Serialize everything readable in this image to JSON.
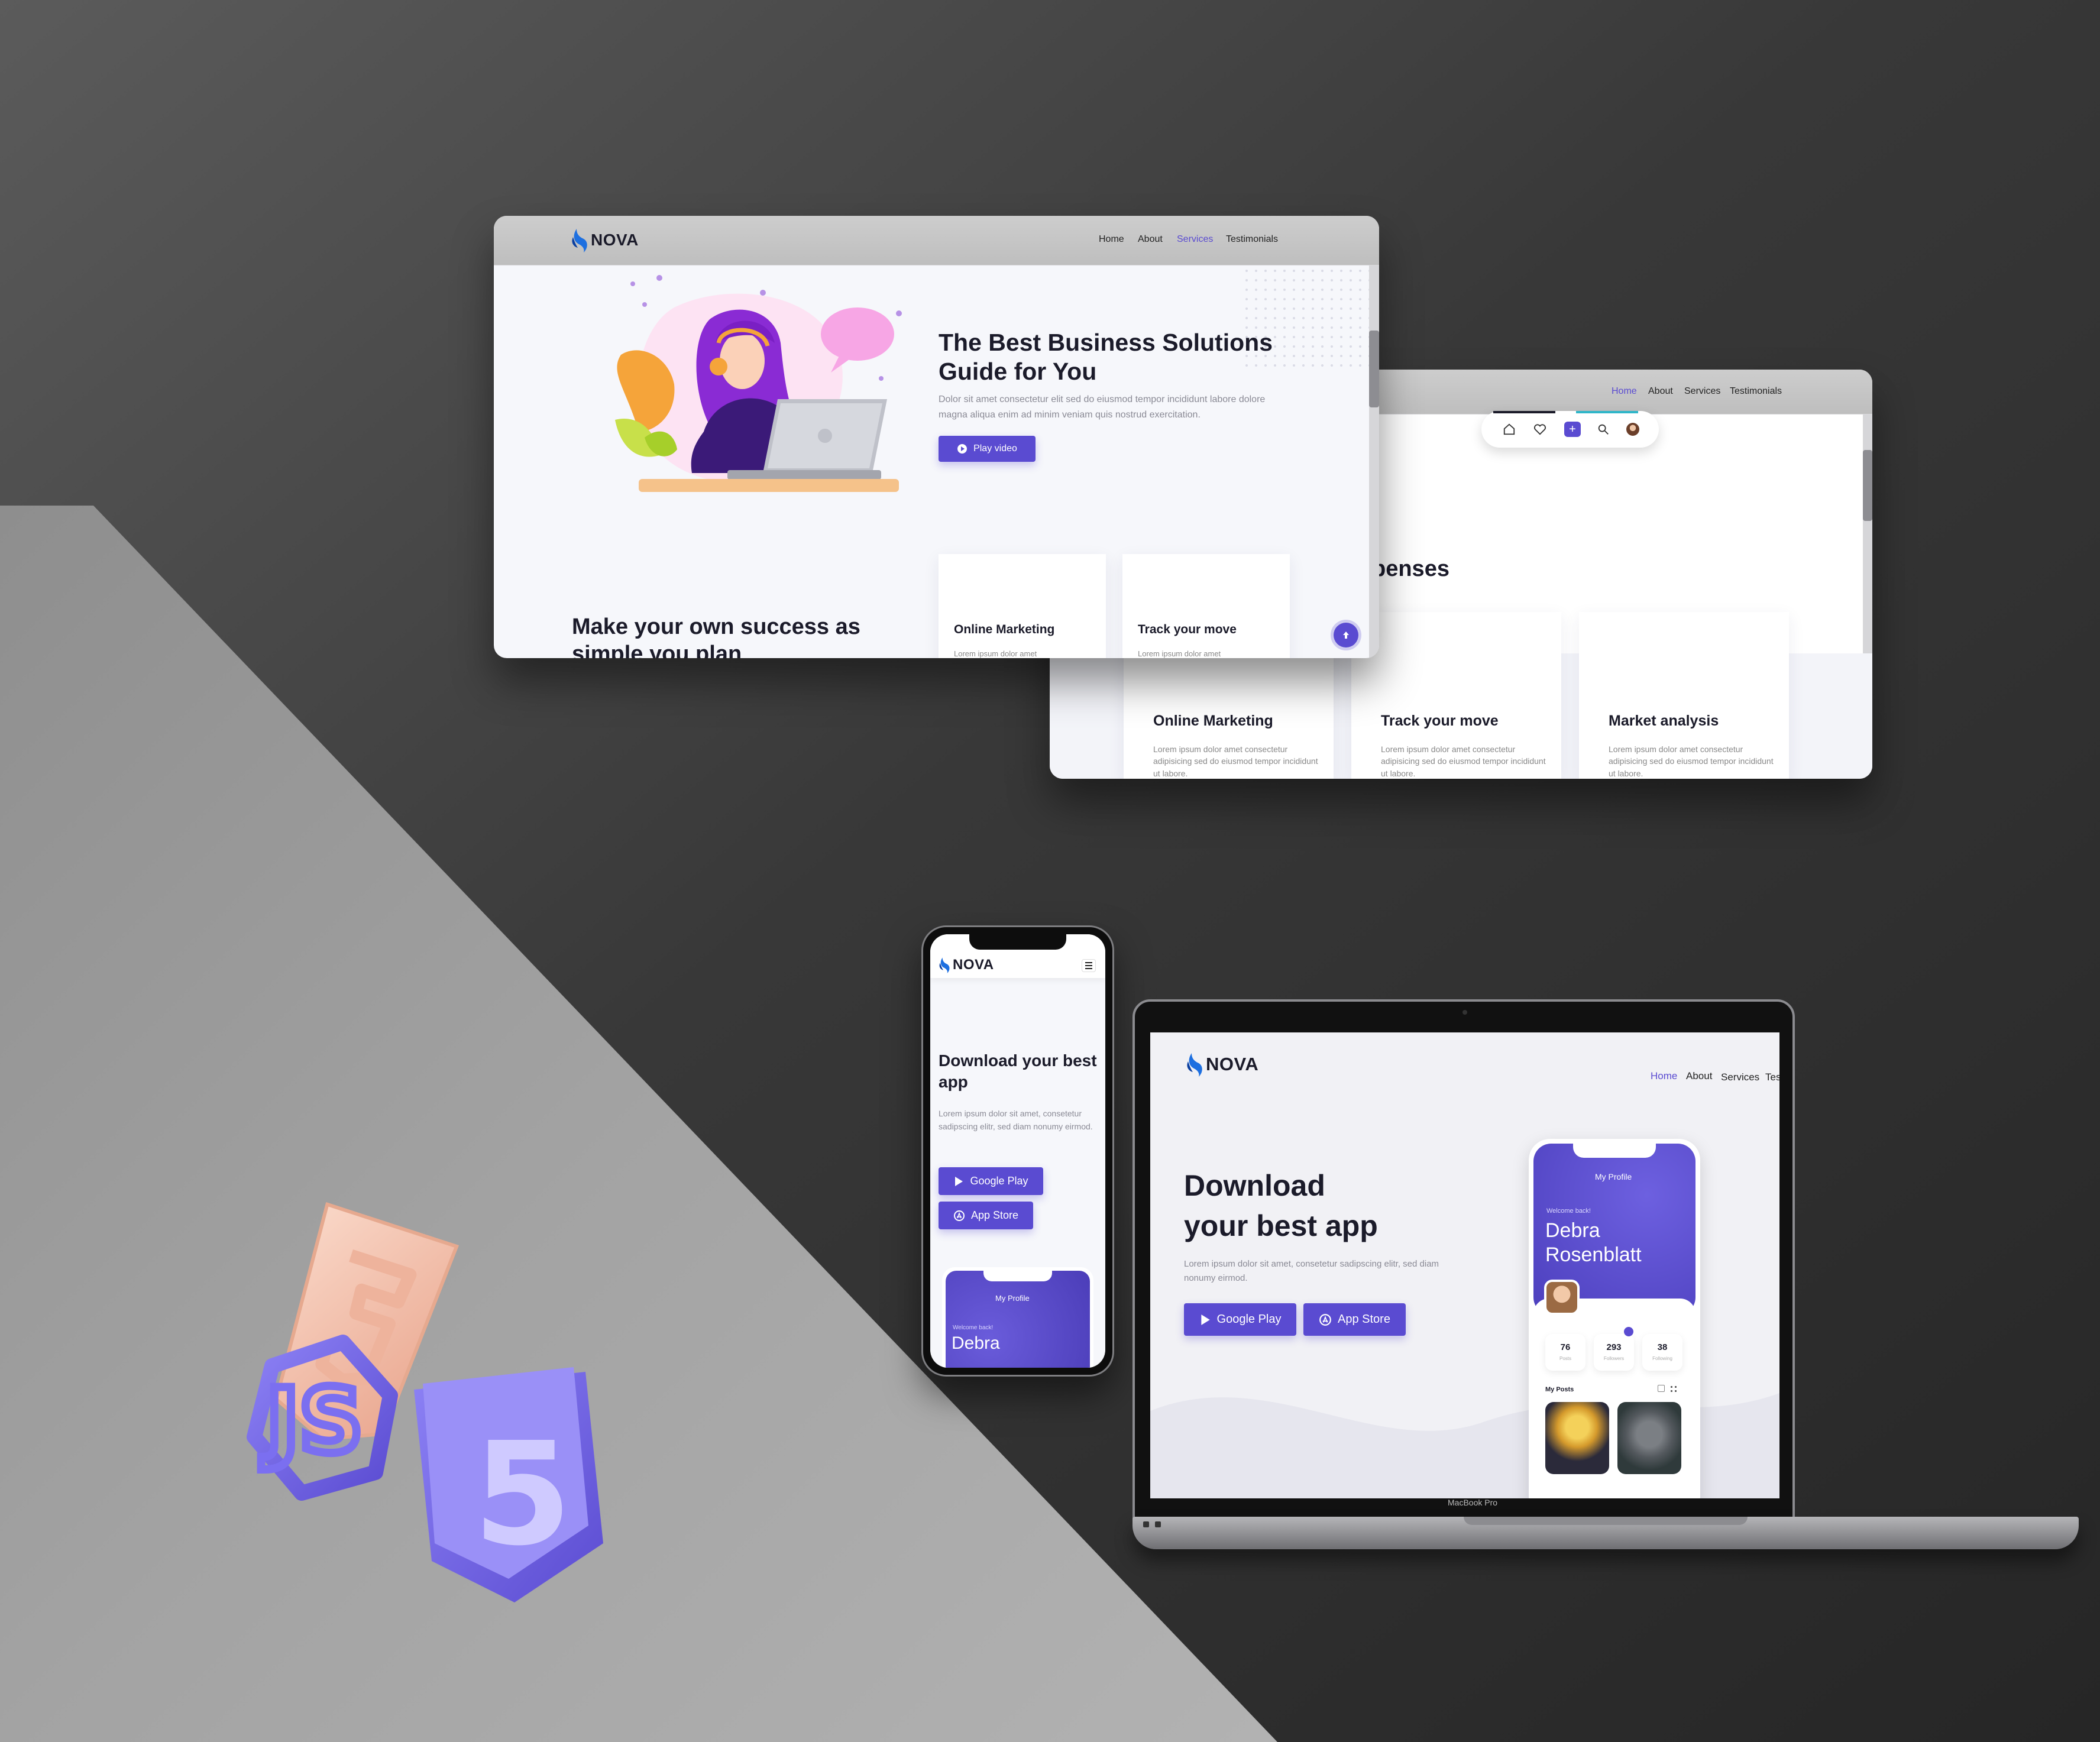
{
  "palette": {
    "accent": "#5a4bd1",
    "dark": "#1b1b2a",
    "muted": "#8a8a95",
    "backdrop": "#2e2e2e"
  },
  "win1": {
    "brand": "NOVA",
    "nav": [
      "Home",
      "About",
      "Services",
      "Testimonials"
    ],
    "active_nav": "Services",
    "hero_title": "The Best Business Solutions Guide for You",
    "hero_text": "Dolor sit amet consectetur elit sed do eiusmod tempor incididunt labore dolore magna aliqua enim ad minim veniam quis nostrud exercitation.",
    "play_label": "Play video",
    "section_title": "Make your own success as simple you plan",
    "cards": [
      {
        "title": "Online Marketing",
        "text": "Lorem ipsum dolor amet"
      },
      {
        "title": "Track your move",
        "text": "Lorem ipsum dolor amet"
      }
    ],
    "icons": [
      "play-icon",
      "arrow-up-icon"
    ]
  },
  "win2": {
    "nav": [
      "Home",
      "About",
      "Services",
      "Testimonials"
    ],
    "active_nav": "Home",
    "section_title_fragment": "penses",
    "toolbar_icons": [
      "home-icon",
      "heart-icon",
      "plus-icon",
      "search-icon",
      "avatar"
    ],
    "cards": [
      {
        "title": "Online Marketing",
        "text": "Lorem ipsum dolor amet consectetur adipisicing sed do eiusmod tempor incididunt ut labore."
      },
      {
        "title": "Track your move",
        "text": "Lorem ipsum dolor amet consectetur adipisicing sed do eiusmod tempor incididunt ut labore."
      },
      {
        "title": "Market analysis",
        "text": "Lorem ipsum dolor amet consectetur adipisicing sed do eiusmod tempor incididunt ut labore."
      }
    ]
  },
  "phone": {
    "brand": "NOVA",
    "title": "Download your best app",
    "text": "Lorem ipsum dolor sit amet, consetetur sadipscing elitr, sed diam nonumy eirmod.",
    "google_label": "Google Play",
    "appstore_label": "App Store",
    "card_header": "My Profile",
    "welcome": "Welcome back!",
    "name": "Debra",
    "icons": [
      "hamburger-icon",
      "google-play-icon",
      "app-store-icon"
    ]
  },
  "laptop": {
    "brand": "NOVA",
    "nav": [
      "Home",
      "About",
      "Services",
      "Tes"
    ],
    "active_nav": "Home",
    "title": "Download your best app",
    "text": "Lorem ipsum dolor sit amet, consetetur sadipscing elitr, sed diam nonumy eirmod.",
    "google_label": "Google Play",
    "appstore_label": "App Store",
    "model_label": "MacBook Pro",
    "profile": {
      "header": "My Profile",
      "welcome": "Welcome back!",
      "name": "Debra Rosenblatt",
      "stats": [
        {
          "value": "76",
          "label": "Posts"
        },
        {
          "value": "293",
          "label": "Followers"
        },
        {
          "value": "38",
          "label": "Following"
        }
      ],
      "posts_label": "My Posts"
    }
  },
  "decor": {
    "html_mark": "5",
    "js_mark": "JS"
  }
}
